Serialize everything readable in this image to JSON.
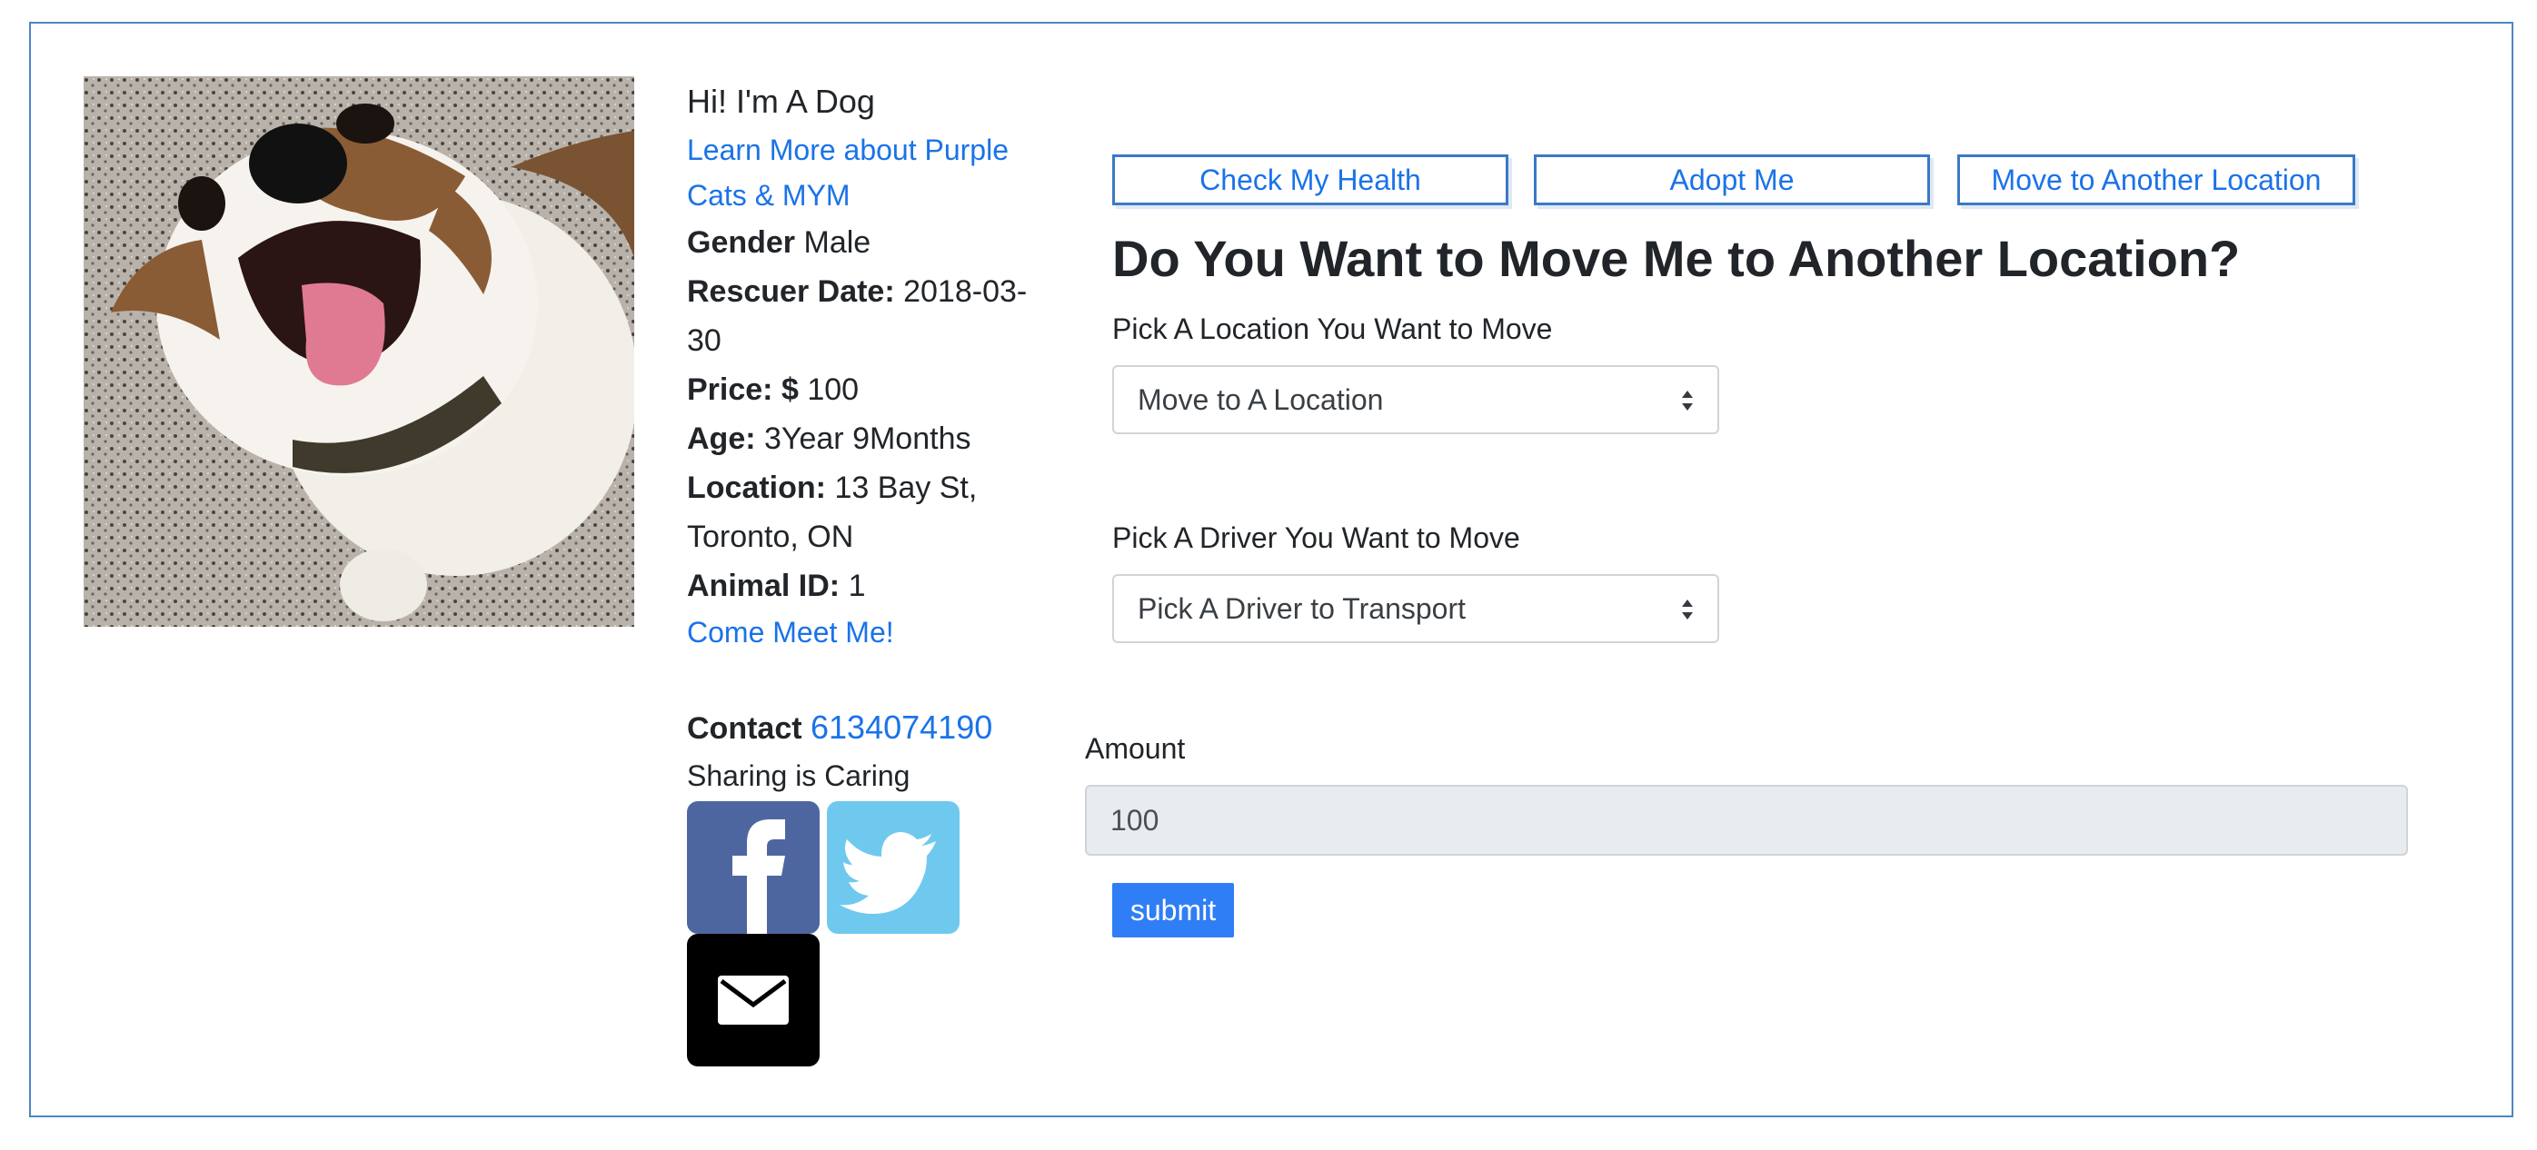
{
  "pet": {
    "greeting": "Hi! I'm A Dog",
    "learn_more": "Learn More about Purple Cats & MYM",
    "gender_label": "Gender",
    "gender": "Male",
    "rescuer_date_label": "Rescuer Date:",
    "rescuer_date": "2018-03-30",
    "price_label": "Price: $",
    "price": "100",
    "age_label": "Age:",
    "age": "3Year 9Months",
    "location_label": "Location:",
    "location": "13 Bay St, Toronto, ON",
    "animal_id_label": "Animal ID:",
    "animal_id": "1",
    "meet_link": "Come Meet Me!",
    "contact_label": "Contact",
    "contact_phone": "6134074190",
    "sharing_text": "Sharing is Caring"
  },
  "actions": {
    "check_health": "Check My Health",
    "adopt": "Adopt Me",
    "move": "Move to Another Location"
  },
  "form": {
    "heading": "Do You Want to Move Me to Another Location?",
    "location_label": "Pick A Location You Want to Move",
    "location_select": "Move to A Location",
    "driver_label": "Pick A Driver You Want to Move",
    "driver_select": "Pick A Driver to Transport",
    "amount_label": "Amount",
    "amount_value": "100",
    "submit_label": "submit"
  },
  "social": {
    "facebook_color": "#4e66a0",
    "twitter_color": "#6fc9ef",
    "email_color": "#000000"
  },
  "colors": {
    "link": "#1a73e8",
    "border": "#4d86c3",
    "submit": "#2f7ef5"
  }
}
